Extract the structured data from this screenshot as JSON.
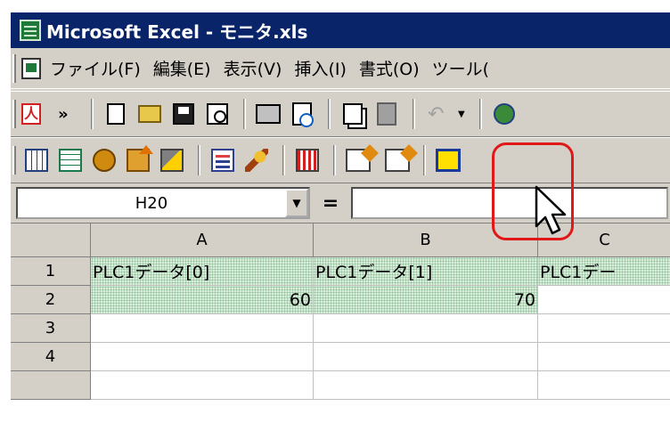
{
  "window": {
    "title": "Microsoft Excel - モニタ.xls"
  },
  "menu": {
    "items": [
      "ファイル(F)",
      "編集(E)",
      "表示(V)",
      "挿入(I)",
      "書式(O)",
      "ツール("
    ]
  },
  "formula_bar": {
    "name_box": "H20",
    "equals": "="
  },
  "sheet": {
    "columns": [
      "A",
      "B",
      "C"
    ],
    "rows": [
      {
        "num": "1",
        "cells": [
          "PLC1データ[0]",
          "PLC1データ[1]",
          "PLC1デー"
        ]
      },
      {
        "num": "2",
        "cells": [
          "60",
          "70",
          ""
        ]
      },
      {
        "num": "3",
        "cells": [
          "",
          "",
          ""
        ]
      },
      {
        "num": "4",
        "cells": [
          "",
          "",
          ""
        ]
      }
    ]
  },
  "icons": {
    "toolbar1": [
      "pdf-icon",
      "chevron-icon",
      "new-icon",
      "open-icon",
      "save-icon",
      "permission-icon",
      "print-icon",
      "print-preview-icon",
      "copy-icon",
      "paste-icon",
      "undo-icon",
      "web-icon"
    ],
    "toolbar2": [
      "grid-icon",
      "grid-icon-2",
      "bug-icon",
      "upload-icon",
      "tools-icon",
      "function-icon",
      "brush-icon",
      "chart-icon",
      "sheet-transfer-icon",
      "sheet-transfer-icon-2",
      "frame-icon"
    ]
  },
  "colors": {
    "titlebar": "#0a246a",
    "highlight": "#e01818",
    "selection": "#d8eddb"
  }
}
